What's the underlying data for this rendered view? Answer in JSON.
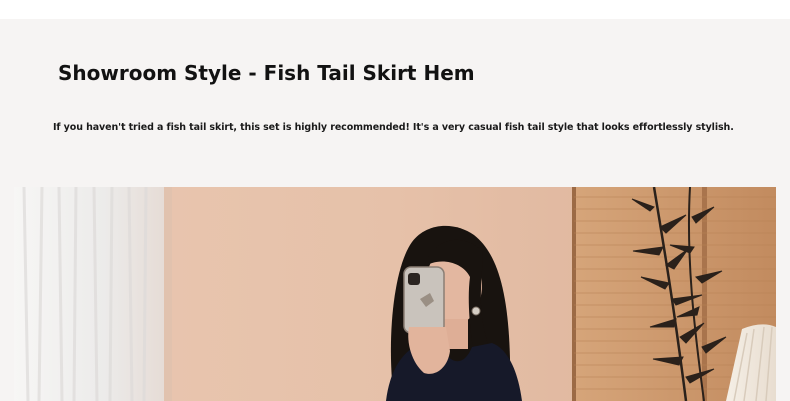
{
  "product": {
    "title": "Showroom Style - Fish Tail Skirt Hem",
    "description": "If you haven't tried a fish tail skirt, this set is highly recommended! It's a very casual fish tail style that looks effortlessly stylish."
  },
  "photo": {
    "subject": "mirror-selfie-photo",
    "colors": {
      "curtain": "#f1efee",
      "wall": "#e7c3ab",
      "blinds": "#cf9a6e",
      "hair": "#18130f",
      "dress": "#161929"
    }
  }
}
